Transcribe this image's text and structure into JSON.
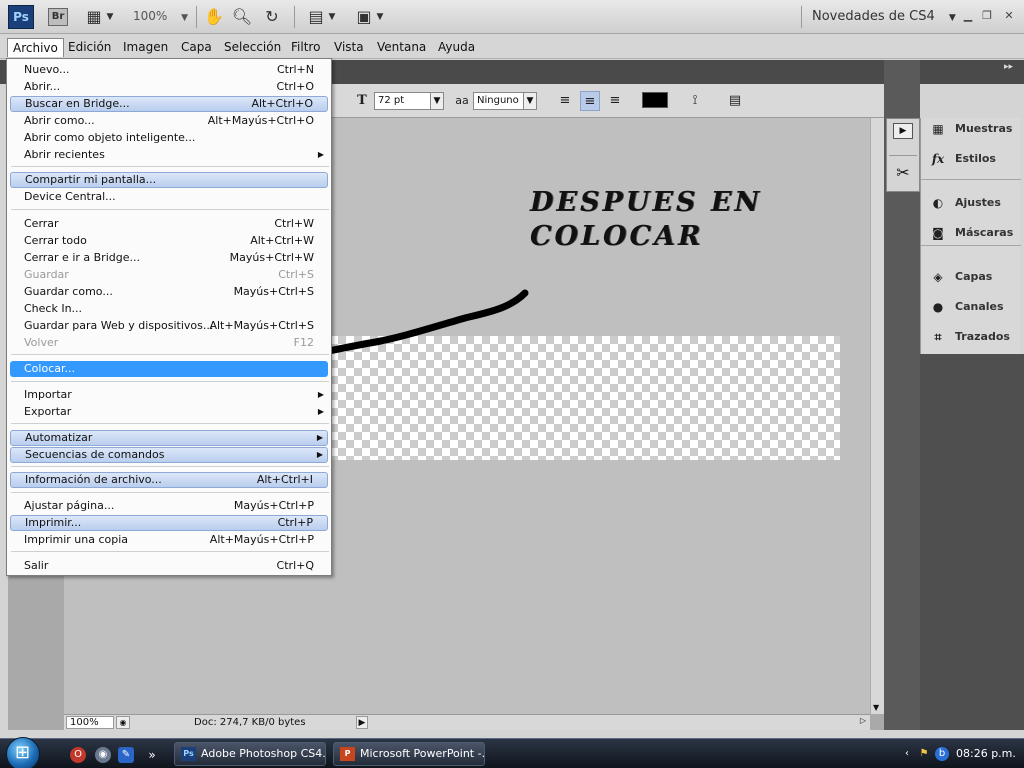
{
  "app": {
    "logo_text": "Ps",
    "bridge_text": "Br",
    "zoom": "100%",
    "workspace": "Novedades de CS4"
  },
  "menubar": [
    "Archivo",
    "Edición",
    "Imagen",
    "Capa",
    "Selección",
    "Filtro",
    "Vista",
    "Ventana",
    "Ayuda"
  ],
  "options": {
    "font_size_icon": "T",
    "font_size": "72 pt",
    "antialias_icon": "aa",
    "antialias": "Ninguno"
  },
  "file_menu": {
    "items": [
      {
        "label": "Nuevo...",
        "shortcut": "Ctrl+N"
      },
      {
        "label": "Abrir...",
        "shortcut": "Ctrl+O"
      },
      {
        "label": "Buscar en Bridge...",
        "shortcut": "Alt+Ctrl+O"
      },
      {
        "label": "Abrir como...",
        "shortcut": "Alt+Mayús+Ctrl+O"
      },
      {
        "label": "Abrir como objeto inteligente...",
        "shortcut": ""
      },
      {
        "label": "Abrir recientes",
        "shortcut": ""
      },
      {
        "label": "Compartir mi pantalla...",
        "shortcut": ""
      },
      {
        "label": "Device Central...",
        "shortcut": ""
      },
      {
        "label": "Cerrar",
        "shortcut": "Ctrl+W"
      },
      {
        "label": "Cerrar todo",
        "shortcut": "Alt+Ctrl+W"
      },
      {
        "label": "Cerrar e ir a Bridge...",
        "shortcut": "Mayús+Ctrl+W"
      },
      {
        "label": "Guardar",
        "shortcut": "Ctrl+S"
      },
      {
        "label": "Guardar como...",
        "shortcut": "Mayús+Ctrl+S"
      },
      {
        "label": "Check In...",
        "shortcut": ""
      },
      {
        "label": "Guardar para Web y dispositivos...",
        "shortcut": "Alt+Mayús+Ctrl+S"
      },
      {
        "label": "Volver",
        "shortcut": "F12"
      },
      {
        "label": "Colocar...",
        "shortcut": ""
      },
      {
        "label": "Importar",
        "shortcut": ""
      },
      {
        "label": "Exportar",
        "shortcut": ""
      },
      {
        "label": "Automatizar",
        "shortcut": ""
      },
      {
        "label": "Secuencias de comandos",
        "shortcut": ""
      },
      {
        "label": "Información de archivo...",
        "shortcut": "Alt+Ctrl+I"
      },
      {
        "label": "Ajustar página...",
        "shortcut": "Mayús+Ctrl+P"
      },
      {
        "label": "Imprimir...",
        "shortcut": "Ctrl+P"
      },
      {
        "label": "Imprimir una copia",
        "shortcut": "Alt+Mayús+Ctrl+P"
      },
      {
        "label": "Salir",
        "shortcut": "Ctrl+Q"
      }
    ]
  },
  "canvas": {
    "text": "DESPUES EN\nCOLOCAR"
  },
  "status": {
    "zoom": "100%",
    "doc": "Doc: 274,7 KB/0 bytes"
  },
  "panels": {
    "muestras": "Muestras",
    "estilos": "Estilos",
    "ajustes": "Ajustes",
    "mascaras": "Máscaras",
    "capas": "Capas",
    "canales": "Canales",
    "trazados": "Trazados",
    "fx_icon": "fx"
  },
  "taskbar": {
    "ps_task": "Adobe Photoshop CS4...",
    "ppt_task": "Microsoft PowerPoint -...",
    "ps_icon": "Ps",
    "ppt_icon": "P",
    "clock": "08:26 p.m."
  }
}
